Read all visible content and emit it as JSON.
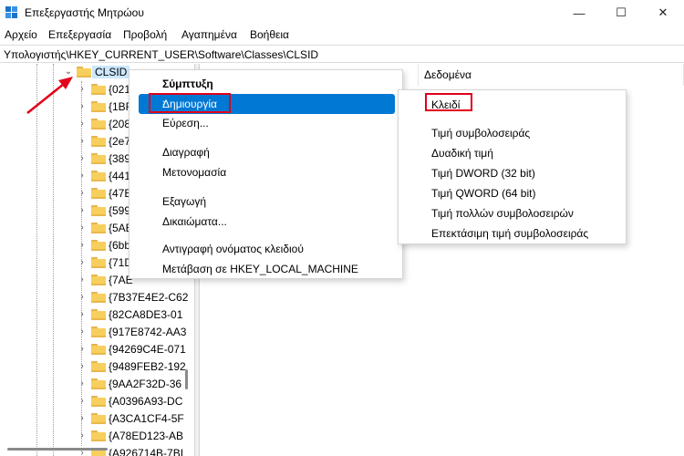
{
  "window": {
    "title": "Επεξεργαστής Μητρώου",
    "minimize_glyph": "—",
    "maximize_glyph": "☐",
    "close_glyph": "✕"
  },
  "menubar": {
    "items": [
      "Αρχείο",
      "Επεξεργασία",
      "Προβολή",
      "Αγαπημένα",
      "Βοήθεια"
    ]
  },
  "address": {
    "path": "Υπολογιστής\\HKEY_CURRENT_USER\\Software\\Classes\\CLSID"
  },
  "tree": {
    "selected": "CLSID",
    "items": [
      "{021",
      "{1BF",
      "{208",
      "{2e7",
      "{389",
      "{441",
      "{47E",
      "{599",
      "{5AE",
      "{6bb",
      "{71D",
      "{7AE",
      "{7B37E4E2-C62",
      "{82CA8DE3-01",
      "{917E8742-AA3",
      "{94269C4E-071",
      "{9489FEB2-192",
      "{9AA2F32D-36",
      "{A0396A93-DC",
      "{A3CA1CF4-5F",
      "{A78ED123-AB",
      "{A926714B-7BI"
    ]
  },
  "columns": {
    "data_header": "Δεδομένα"
  },
  "context_menu": {
    "expand": "Σύμπτυξη",
    "new": "Δημιουργία",
    "find": "Εύρεση...",
    "delete": "Διαγραφή",
    "rename": "Μετονομασία",
    "export": "Εξαγωγή",
    "permissions": "Δικαιώματα...",
    "copy_key_name": "Αντιγραφή ονόματος κλειδιού",
    "goto_hklm": "Μετάβαση σε HKEY_LOCAL_MACHINE",
    "submenu_arrow": "›"
  },
  "new_submenu": {
    "items": [
      "Κλειδί",
      "Τιμή συμβολοσειράς",
      "Δυαδική τιμή",
      "Τιμή DWORD (32 bit)",
      "Τιμή QWORD (64 bit)",
      "Τιμή πολλών συμβολοσειρών",
      "Επεκτάσιμη τιμή συμβολοσειράς"
    ]
  },
  "colors": {
    "highlight": "#0078d4",
    "annotation_red": "#e2001a",
    "folder": "#f7cf5d"
  }
}
